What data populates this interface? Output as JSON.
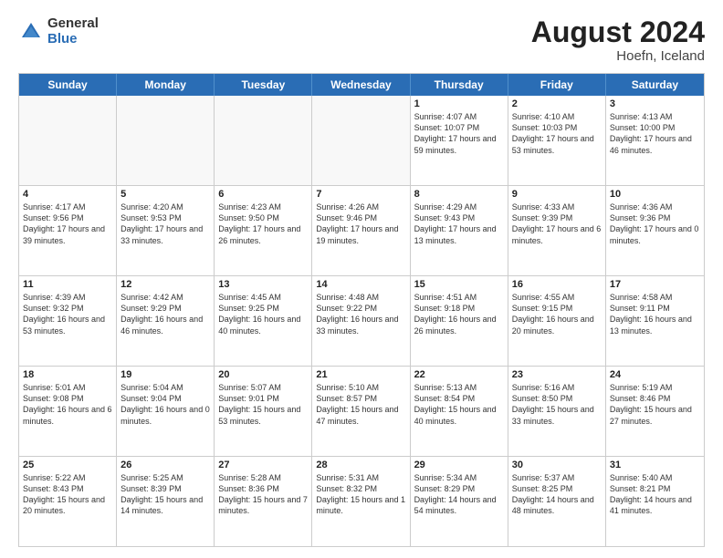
{
  "logo": {
    "general": "General",
    "blue": "Blue"
  },
  "title": "August 2024",
  "location": "Hoefn, Iceland",
  "header_days": [
    "Sunday",
    "Monday",
    "Tuesday",
    "Wednesday",
    "Thursday",
    "Friday",
    "Saturday"
  ],
  "weeks": [
    [
      {
        "day": "",
        "text": "",
        "empty": true
      },
      {
        "day": "",
        "text": "",
        "empty": true
      },
      {
        "day": "",
        "text": "",
        "empty": true
      },
      {
        "day": "",
        "text": "",
        "empty": true
      },
      {
        "day": "1",
        "text": "Sunrise: 4:07 AM\nSunset: 10:07 PM\nDaylight: 17 hours\nand 59 minutes.",
        "empty": false
      },
      {
        "day": "2",
        "text": "Sunrise: 4:10 AM\nSunset: 10:03 PM\nDaylight: 17 hours\nand 53 minutes.",
        "empty": false
      },
      {
        "day": "3",
        "text": "Sunrise: 4:13 AM\nSunset: 10:00 PM\nDaylight: 17 hours\nand 46 minutes.",
        "empty": false
      }
    ],
    [
      {
        "day": "4",
        "text": "Sunrise: 4:17 AM\nSunset: 9:56 PM\nDaylight: 17 hours\nand 39 minutes.",
        "empty": false
      },
      {
        "day": "5",
        "text": "Sunrise: 4:20 AM\nSunset: 9:53 PM\nDaylight: 17 hours\nand 33 minutes.",
        "empty": false
      },
      {
        "day": "6",
        "text": "Sunrise: 4:23 AM\nSunset: 9:50 PM\nDaylight: 17 hours\nand 26 minutes.",
        "empty": false
      },
      {
        "day": "7",
        "text": "Sunrise: 4:26 AM\nSunset: 9:46 PM\nDaylight: 17 hours\nand 19 minutes.",
        "empty": false
      },
      {
        "day": "8",
        "text": "Sunrise: 4:29 AM\nSunset: 9:43 PM\nDaylight: 17 hours\nand 13 minutes.",
        "empty": false
      },
      {
        "day": "9",
        "text": "Sunrise: 4:33 AM\nSunset: 9:39 PM\nDaylight: 17 hours\nand 6 minutes.",
        "empty": false
      },
      {
        "day": "10",
        "text": "Sunrise: 4:36 AM\nSunset: 9:36 PM\nDaylight: 17 hours\nand 0 minutes.",
        "empty": false
      }
    ],
    [
      {
        "day": "11",
        "text": "Sunrise: 4:39 AM\nSunset: 9:32 PM\nDaylight: 16 hours\nand 53 minutes.",
        "empty": false
      },
      {
        "day": "12",
        "text": "Sunrise: 4:42 AM\nSunset: 9:29 PM\nDaylight: 16 hours\nand 46 minutes.",
        "empty": false
      },
      {
        "day": "13",
        "text": "Sunrise: 4:45 AM\nSunset: 9:25 PM\nDaylight: 16 hours\nand 40 minutes.",
        "empty": false
      },
      {
        "day": "14",
        "text": "Sunrise: 4:48 AM\nSunset: 9:22 PM\nDaylight: 16 hours\nand 33 minutes.",
        "empty": false
      },
      {
        "day": "15",
        "text": "Sunrise: 4:51 AM\nSunset: 9:18 PM\nDaylight: 16 hours\nand 26 minutes.",
        "empty": false
      },
      {
        "day": "16",
        "text": "Sunrise: 4:55 AM\nSunset: 9:15 PM\nDaylight: 16 hours\nand 20 minutes.",
        "empty": false
      },
      {
        "day": "17",
        "text": "Sunrise: 4:58 AM\nSunset: 9:11 PM\nDaylight: 16 hours\nand 13 minutes.",
        "empty": false
      }
    ],
    [
      {
        "day": "18",
        "text": "Sunrise: 5:01 AM\nSunset: 9:08 PM\nDaylight: 16 hours\nand 6 minutes.",
        "empty": false
      },
      {
        "day": "19",
        "text": "Sunrise: 5:04 AM\nSunset: 9:04 PM\nDaylight: 16 hours\nand 0 minutes.",
        "empty": false
      },
      {
        "day": "20",
        "text": "Sunrise: 5:07 AM\nSunset: 9:01 PM\nDaylight: 15 hours\nand 53 minutes.",
        "empty": false
      },
      {
        "day": "21",
        "text": "Sunrise: 5:10 AM\nSunset: 8:57 PM\nDaylight: 15 hours\nand 47 minutes.",
        "empty": false
      },
      {
        "day": "22",
        "text": "Sunrise: 5:13 AM\nSunset: 8:54 PM\nDaylight: 15 hours\nand 40 minutes.",
        "empty": false
      },
      {
        "day": "23",
        "text": "Sunrise: 5:16 AM\nSunset: 8:50 PM\nDaylight: 15 hours\nand 33 minutes.",
        "empty": false
      },
      {
        "day": "24",
        "text": "Sunrise: 5:19 AM\nSunset: 8:46 PM\nDaylight: 15 hours\nand 27 minutes.",
        "empty": false
      }
    ],
    [
      {
        "day": "25",
        "text": "Sunrise: 5:22 AM\nSunset: 8:43 PM\nDaylight: 15 hours\nand 20 minutes.",
        "empty": false
      },
      {
        "day": "26",
        "text": "Sunrise: 5:25 AM\nSunset: 8:39 PM\nDaylight: 15 hours\nand 14 minutes.",
        "empty": false
      },
      {
        "day": "27",
        "text": "Sunrise: 5:28 AM\nSunset: 8:36 PM\nDaylight: 15 hours\nand 7 minutes.",
        "empty": false
      },
      {
        "day": "28",
        "text": "Sunrise: 5:31 AM\nSunset: 8:32 PM\nDaylight: 15 hours\nand 1 minute.",
        "empty": false
      },
      {
        "day": "29",
        "text": "Sunrise: 5:34 AM\nSunset: 8:29 PM\nDaylight: 14 hours\nand 54 minutes.",
        "empty": false
      },
      {
        "day": "30",
        "text": "Sunrise: 5:37 AM\nSunset: 8:25 PM\nDaylight: 14 hours\nand 48 minutes.",
        "empty": false
      },
      {
        "day": "31",
        "text": "Sunrise: 5:40 AM\nSunset: 8:21 PM\nDaylight: 14 hours\nand 41 minutes.",
        "empty": false
      }
    ]
  ]
}
